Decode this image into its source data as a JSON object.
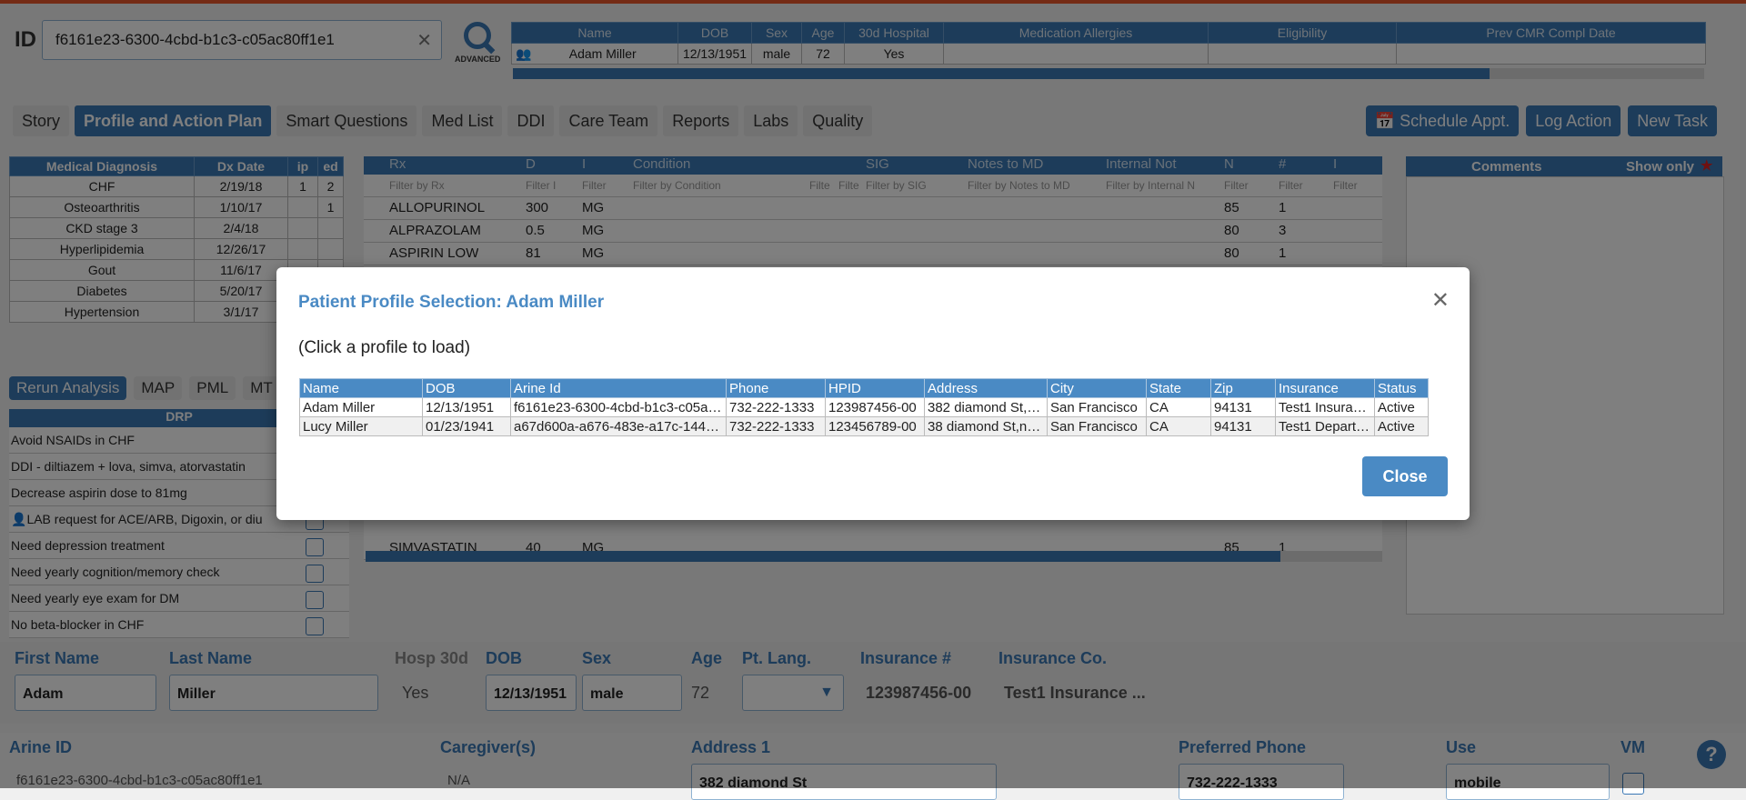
{
  "search": {
    "label": "ID",
    "value": "f6161e23-6300-4cbd-b1c3-c05ac80ff1e1",
    "advanced_label": "ADVANCED"
  },
  "patient_table": {
    "headers": [
      "Name",
      "DOB",
      "Sex",
      "Age",
      "30d Hospital",
      "Medication Allergies",
      "Eligibility",
      "Prev CMR Compl Date"
    ],
    "row": [
      "Adam Miller",
      "12/13/1951",
      "male",
      "72",
      "Yes",
      "",
      "",
      ""
    ],
    "progress": 0.82
  },
  "tabs": [
    "Story",
    "Profile and Action Plan",
    "Smart Questions",
    "Med List",
    "DDI",
    "Care Team",
    "Reports",
    "Labs",
    "Quality"
  ],
  "actions": {
    "schedule": "Schedule Appt.",
    "log": "Log Action",
    "task": "New Task"
  },
  "diagnosis": {
    "headers": [
      "Medical Diagnosis",
      "Dx Date",
      "ip",
      "ed"
    ],
    "rows": [
      [
        "CHF",
        "2/19/18",
        "1",
        "2"
      ],
      [
        "Osteoarthritis",
        "1/10/17",
        "",
        "1"
      ],
      [
        "CKD stage 3",
        "2/4/18",
        "",
        ""
      ],
      [
        "Hyperlipidemia",
        "12/26/17",
        "",
        ""
      ],
      [
        "Gout",
        "11/6/17",
        "",
        ""
      ],
      [
        "Diabetes",
        "5/20/17",
        "",
        ""
      ],
      [
        "Hypertension",
        "3/1/17",
        "",
        ""
      ]
    ]
  },
  "analysis_buttons": {
    "rerun": "Rerun Analysis",
    "map": "MAP",
    "pml": "PML",
    "mt": "MT"
  },
  "drp": {
    "header": "DRP",
    "items": [
      "Avoid NSAIDs in CHF",
      "DDI - diltiazem + lova, simva, atorvastatin",
      "Decrease aspirin dose to 81mg",
      "LAB request for ACE/ARB, Digoxin, or diu",
      "Need depression treatment",
      "Need yearly cognition/memory check",
      "Need yearly eye exam for DM",
      "No beta-blocker in CHF"
    ]
  },
  "medlist": {
    "headers": [
      "Rx",
      "D",
      "I",
      "Condition",
      "SIG",
      "Notes to MD",
      "Internal Not",
      "N",
      "#",
      "I"
    ],
    "filters": [
      "Filter by Rx",
      "Filter I",
      "Filter",
      "Filter by Condition",
      "Filte",
      "Filte",
      "Filter by SIG",
      "Filter by Notes to MD",
      "Filter by Internal N",
      "Filter",
      "Filter",
      "Filter"
    ],
    "rows": [
      [
        "ALLOPURINOL",
        "300",
        "MG",
        "85",
        "1"
      ],
      [
        "ALPRAZOLAM",
        "0.5",
        "MG",
        "80",
        "3"
      ],
      [
        "ASPIRIN LOW",
        "81",
        "MG",
        "80",
        "1"
      ],
      [
        "SIMVASTATIN",
        "40",
        "MG",
        "85",
        "1"
      ]
    ],
    "progress": 0.9
  },
  "comments": {
    "title": "Comments",
    "show_only": "Show only"
  },
  "form": {
    "first_name_label": "First Name",
    "first_name": "Adam",
    "last_name_label": "Last Name",
    "last_name": "Miller",
    "hosp_label": "Hosp 30d",
    "hosp": "Yes",
    "dob_label": "DOB",
    "dob": "12/13/1951",
    "sex_label": "Sex",
    "sex": "male",
    "age_label": "Age",
    "age": "72",
    "lang_label": "Pt. Lang.",
    "ins_num_label": "Insurance #",
    "ins_num": "123987456-00",
    "ins_co_label": "Insurance Co.",
    "ins_co": "Test1 Insurance ...",
    "arine_label": "Arine ID",
    "arine": "f6161e23-6300-4cbd-b1c3-c05ac80ff1e1",
    "caregiver_label": "Caregiver(s)",
    "caregiver": "N/A",
    "address_label": "Address 1",
    "address": "382 diamond St",
    "phone_label": "Preferred Phone",
    "phone": "732-222-1333",
    "use_label": "Use",
    "use": "mobile",
    "vm_label": "VM"
  },
  "help": "?",
  "modal": {
    "title": "Patient Profile Selection: Adam Miller",
    "hint": "(Click a profile to load)",
    "headers": [
      "Name",
      "DOB",
      "Arine Id",
      "Phone",
      "HPID",
      "Address",
      "City",
      "State",
      "Zip",
      "Insurance",
      "Status"
    ],
    "rows": [
      [
        "Adam Miller",
        "12/13/1951",
        "f6161e23-6300-4cbd-b1c3-c05a…",
        "732-222-1333",
        "123987456-00",
        "382 diamond St,…",
        "San Francisco",
        "CA",
        "94131",
        "Test1 Insura…",
        "Active"
      ],
      [
        "Lucy Miller",
        "01/23/1941",
        "a67d600a-a676-483e-a17c-144…",
        "732-222-1333",
        "123456789-00",
        "38 diamond St,n…",
        "San Francisco",
        "CA",
        "94131",
        "Test1 Depart…",
        "Active"
      ]
    ],
    "close": "Close"
  }
}
